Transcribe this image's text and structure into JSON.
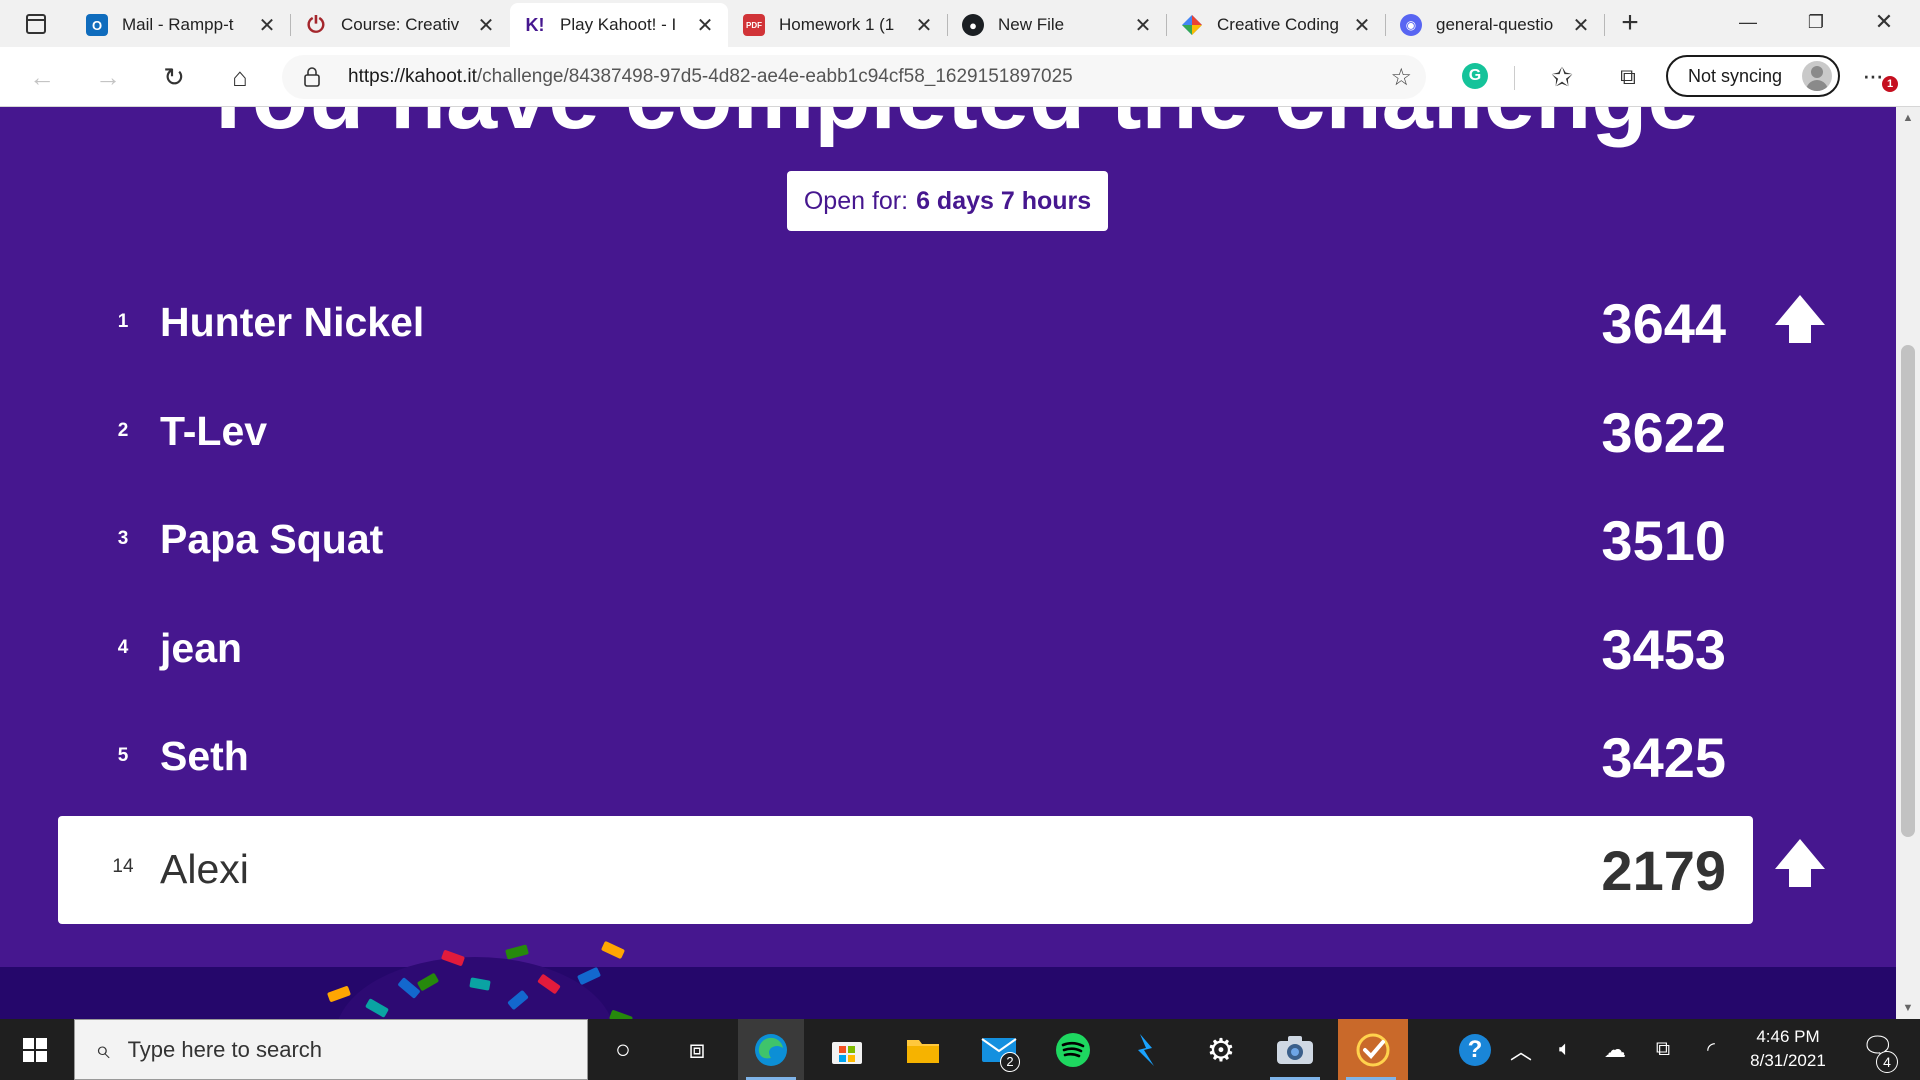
{
  "browser": {
    "tabs": [
      {
        "title": "Mail - Rampp-t",
        "favicon": "outlook-icon",
        "color": "#0f6cbd",
        "active": false
      },
      {
        "title": "Course: Creativ",
        "favicon": "power-icon",
        "color": "#a4262c",
        "active": false
      },
      {
        "title": "Play Kahoot! - I",
        "favicon": "kahoot-icon",
        "color": "#46178f",
        "active": true
      },
      {
        "title": "Homework 1 (1",
        "favicon": "pdf-icon",
        "color": "#d13438",
        "active": false
      },
      {
        "title": "New File",
        "favicon": "github-icon",
        "color": "#1b1f23",
        "active": false
      },
      {
        "title": "Creative Coding",
        "favicon": "colorful-logo-icon",
        "color": "#e94235",
        "active": false
      },
      {
        "title": "general-questio",
        "favicon": "discord-icon",
        "color": "#5865f2",
        "active": false
      }
    ],
    "kahoot_favicon_text": "K!",
    "address": {
      "domain": "https://kahoot.it",
      "path": "/challenge/84387498-97d5-4d82-ae4e-eabb1c94cf58_1629151897025"
    },
    "grammarly_letter": "G",
    "sync_label": "Not syncing",
    "more_badge": "1"
  },
  "page": {
    "heading": "You have completed the challenge",
    "open_for_label": "Open for:",
    "open_for_value": "6 days 7 hours",
    "background_color": "#46178f",
    "leaderboard": [
      {
        "rank": "1",
        "name": "Hunter Nickel",
        "score": "3644",
        "arrow": true
      },
      {
        "rank": "2",
        "name": "T-Lev",
        "score": "3622",
        "arrow": false
      },
      {
        "rank": "3",
        "name": "Papa Squat",
        "score": "3510",
        "arrow": false
      },
      {
        "rank": "4",
        "name": "jean",
        "score": "3453",
        "arrow": false
      },
      {
        "rank": "5",
        "name": "Seth",
        "score": "3425",
        "arrow": false
      }
    ],
    "current_player": {
      "rank": "14",
      "name": "Alexi",
      "score": "2179",
      "arrow": true
    }
  },
  "taskbar": {
    "search_placeholder": "Type here to search",
    "mail_badge": "2",
    "time": "4:46 PM",
    "date": "8/31/2021",
    "notification_count": "4"
  }
}
